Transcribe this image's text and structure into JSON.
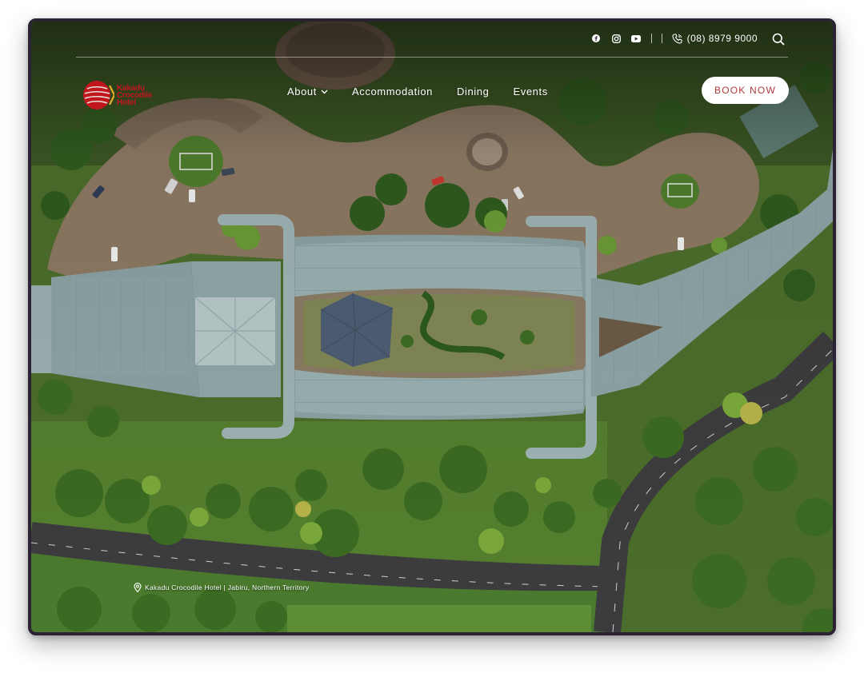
{
  "brand": {
    "name_line1": "Kakadu",
    "name_line2": "Crocodile",
    "name_line3": "Hotel",
    "color": "#c2161e"
  },
  "utility": {
    "social": [
      "facebook-icon",
      "instagram-icon",
      "youtube-icon"
    ],
    "phone": "(08) 8979 9000"
  },
  "nav": {
    "items": [
      {
        "label": "About",
        "has_dropdown": true
      },
      {
        "label": "Accommodation"
      },
      {
        "label": "Dining"
      },
      {
        "label": "Events"
      }
    ],
    "book_label": "BOOK NOW"
  },
  "hero": {
    "caption": "Kakadu Crocodile Hotel | Jabiru, Northern Territory"
  },
  "colors": {
    "accent": "#b23a3a",
    "grass": "#4e7a2c",
    "roof": "#8fa5a6",
    "road": "#3c3c3e",
    "dirt": "#8b7862"
  }
}
